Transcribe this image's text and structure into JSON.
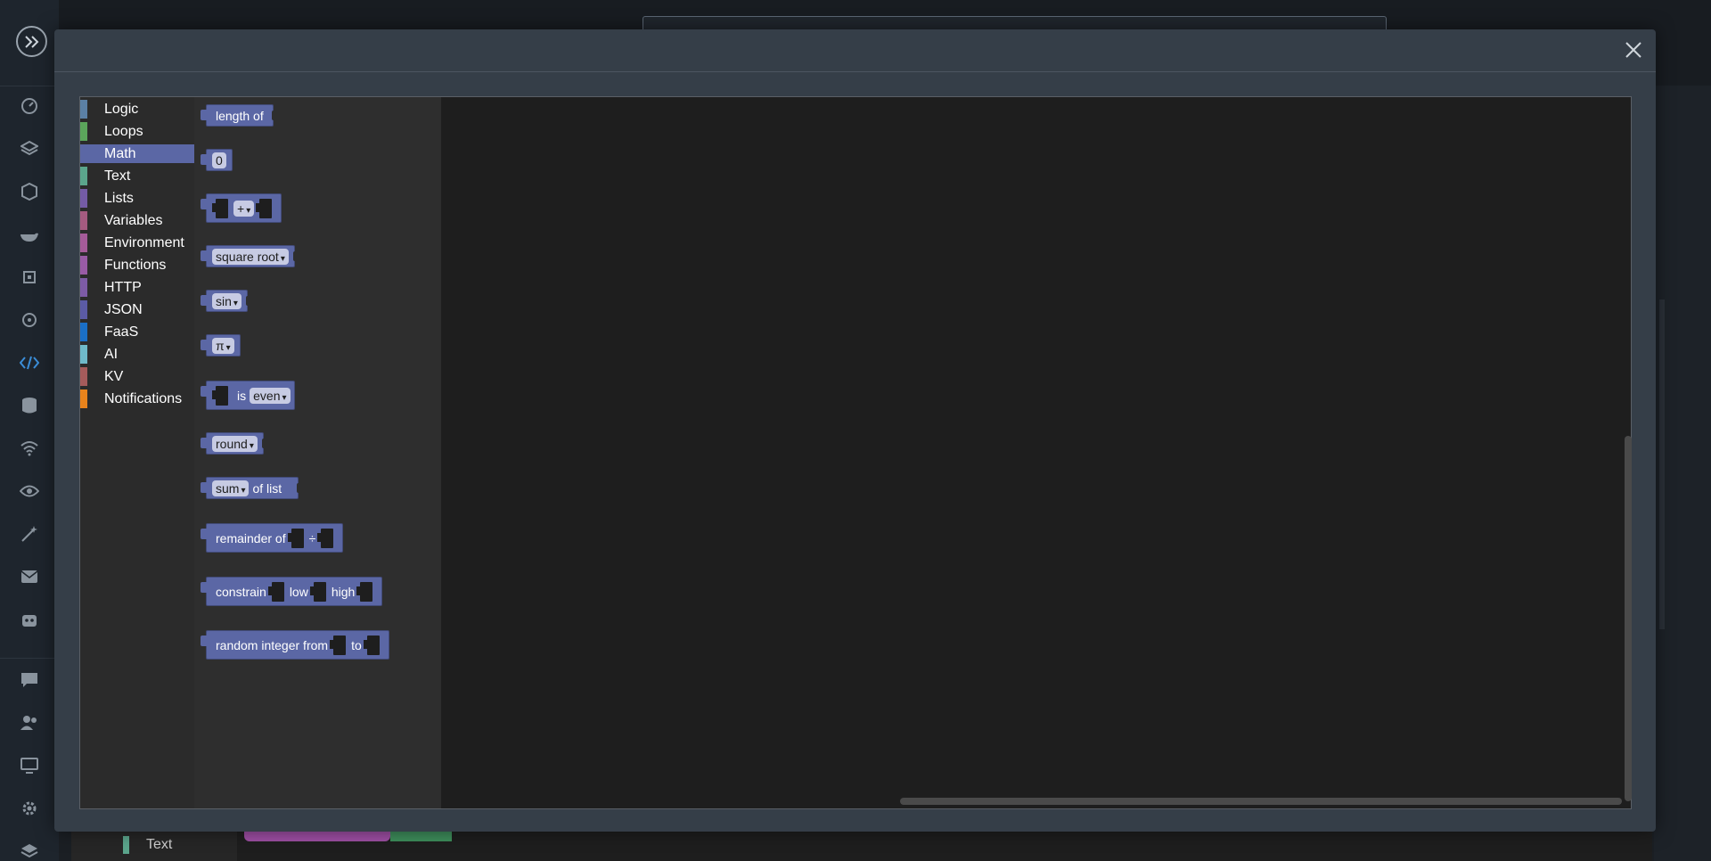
{
  "modal": {
    "close_label": "×"
  },
  "toolbox": {
    "categories": [
      {
        "label": "Logic",
        "color": "#5b80a5"
      },
      {
        "label": "Loops",
        "color": "#5ba55b"
      },
      {
        "label": "Math",
        "color": "#5b67a5",
        "selected": true
      },
      {
        "label": "Text",
        "color": "#5ba58c"
      },
      {
        "label": "Lists",
        "color": "#745ba5"
      },
      {
        "label": "Variables",
        "color": "#a55b80"
      },
      {
        "label": "Environment",
        "color": "#a55b99"
      },
      {
        "label": "Functions",
        "color": "#995ba5"
      },
      {
        "label": "HTTP",
        "color": "#7d5ba5"
      },
      {
        "label": "JSON",
        "color": "#5b5ba5"
      },
      {
        "label": "FaaS",
        "color": "#1a6fc6"
      },
      {
        "label": "AI",
        "color": "#6fb9c9"
      },
      {
        "label": "KV",
        "color": "#a55b5b"
      },
      {
        "label": "Notifications",
        "color": "#e8831c"
      }
    ]
  },
  "flyout": {
    "length_of": "length of",
    "number": "0",
    "arith_op": "+",
    "single_op": "square root",
    "trig_op": "sin",
    "constant": "π",
    "is": "is",
    "property": "even",
    "round_op": "round",
    "list_op": "sum",
    "of_list": "of list",
    "remainder_of": "remainder of",
    "divide": "÷",
    "constrain": "constrain",
    "low": "low",
    "high": "high",
    "random_int_from": "random integer from",
    "to": "to",
    "dropdown_arrow": "▾"
  },
  "background": {
    "sidebar_text_item": "Text"
  }
}
